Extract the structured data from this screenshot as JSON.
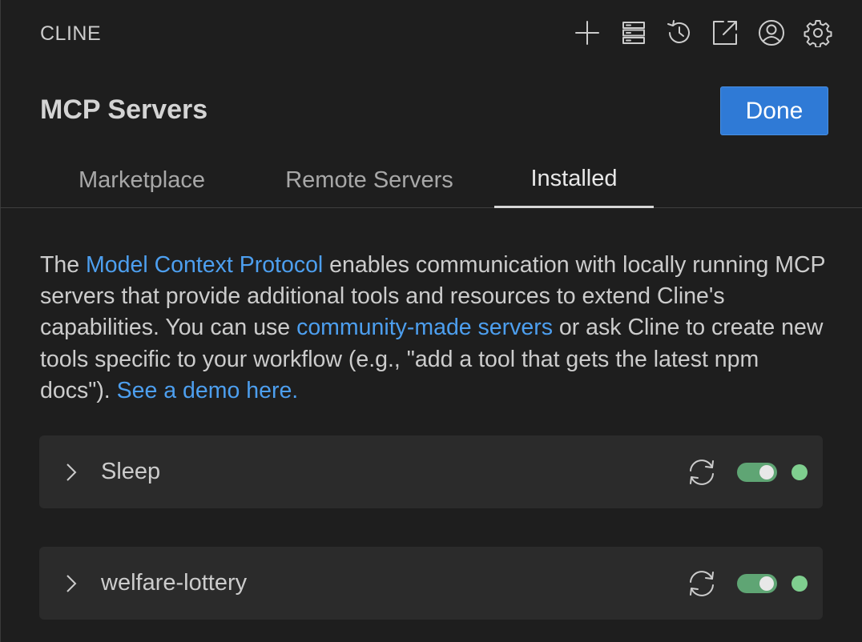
{
  "app": {
    "title": "CLINE"
  },
  "toolbar": {
    "icons": [
      "plus-icon",
      "server-icon",
      "history-icon",
      "popout-icon",
      "account-icon",
      "settings-icon"
    ]
  },
  "header": {
    "title": "MCP Servers",
    "done_label": "Done"
  },
  "tabs": [
    {
      "label": "Marketplace",
      "active": false
    },
    {
      "label": "Remote Servers",
      "active": false
    },
    {
      "label": "Installed",
      "active": true
    }
  ],
  "description": {
    "part1": "The ",
    "link1": "Model Context Protocol",
    "part2": " enables communication with locally running MCP servers that provide additional tools and resources to extend Cline's capabilities. You can use ",
    "link2": "community-made servers",
    "part3": " or ask Cline to create new tools specific to your workflow (e.g., \"add a tool that gets the latest npm docs\"). ",
    "link3": "See a demo here."
  },
  "servers": [
    {
      "name": "Sleep",
      "enabled": true,
      "status": "connected"
    },
    {
      "name": "welfare-lottery",
      "enabled": true,
      "status": "connected"
    }
  ],
  "colors": {
    "accent": "#2f7ad6",
    "link": "#4d9fef",
    "status_connected": "#7fcf8f",
    "toggle_on": "#5fa574"
  }
}
